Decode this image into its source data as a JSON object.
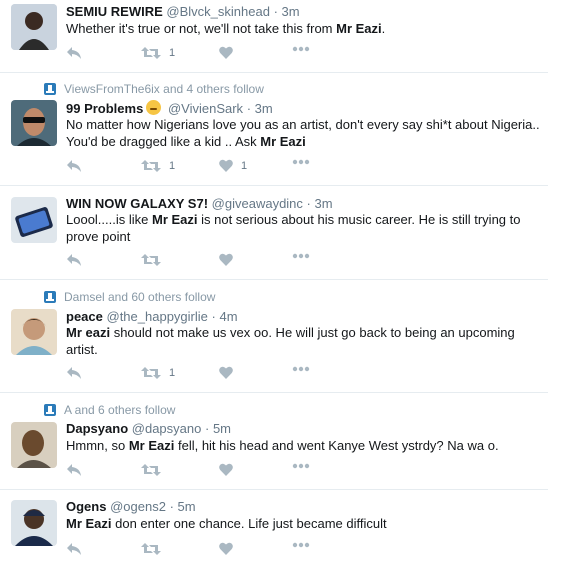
{
  "tweets": [
    {
      "context": "",
      "name": "SEMIU REWIRE",
      "handle": "@Blvck_skinhead",
      "time": "3m",
      "text_before": "Whether it's true or not, we'll not take this from ",
      "text_bold": "Mr Eazi",
      "text_after": ".",
      "retweets": "1",
      "likes": ""
    },
    {
      "context": "ViewsFromThe6ix and 4 others follow",
      "name": "99 Problems",
      "handle": "@VivienSark",
      "time": "3m",
      "text_before": "No matter how Nigerians love you as an artist, don't every say shi*t about Nigeria.. You'd be dragged like a kid .. Ask ",
      "text_bold": "Mr Eazi",
      "text_after": "",
      "retweets": "1",
      "likes": "1"
    },
    {
      "context": "",
      "name": "WIN NOW GALAXY S7!",
      "handle": "@giveawaydinc",
      "time": "3m",
      "text_before": "Loool.....is like ",
      "text_bold": "Mr Eazi",
      "text_after": " is not serious about his music career. He is still trying to prove point",
      "retweets": "",
      "likes": ""
    },
    {
      "context": "Damsel and 60 others follow",
      "name": "peace",
      "handle": "@the_happygirlie",
      "time": "4m",
      "text_before": "",
      "text_bold": "Mr eazi",
      "text_after": " should not make us vex oo.  He will just go back to being an upcoming artist.",
      "retweets": "1",
      "likes": ""
    },
    {
      "context": "A and 6 others follow",
      "name": "Dapsyano",
      "handle": "@dapsyano",
      "time": "5m",
      "text_before": "Hmmn, so ",
      "text_bold": "Mr Eazi",
      "text_after": " fell, hit his head and went Kanye West ystrdy? Na wa o.",
      "retweets": "",
      "likes": ""
    },
    {
      "context": "",
      "name": "Ogens",
      "handle": "@ogens2",
      "time": "5m",
      "text_before": "",
      "text_bold": "Mr Eazi",
      "text_after": " don enter one chance. Life just became difficult",
      "retweets": "",
      "likes": ""
    }
  ],
  "separator": "·",
  "icons": {
    "reply": "reply-icon",
    "retweet": "retweet-icon",
    "like": "heart-icon",
    "more": "more-icon",
    "follow": "follow-icon"
  },
  "colors": {
    "icon": "#aab8c2",
    "muted": "#657786",
    "text": "#14171a",
    "follow_icon": "#2b7bb9"
  }
}
